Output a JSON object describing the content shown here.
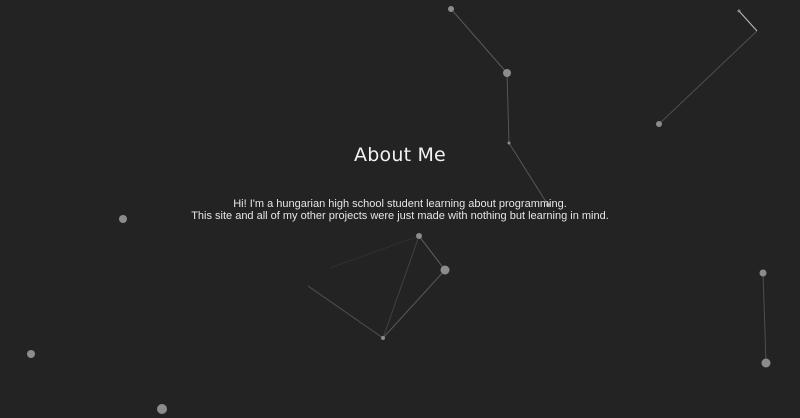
{
  "about": {
    "title": "About Me",
    "line1": "Hi! I'm a hungarian high school student learning about programming.",
    "line2": "This site and all of my other projects were just made with nothing but learning in mind."
  },
  "colors": {
    "background": "#232323",
    "text": "#f2f2f2",
    "particle": "#8a8a8a",
    "link": "#7a7a7a"
  }
}
